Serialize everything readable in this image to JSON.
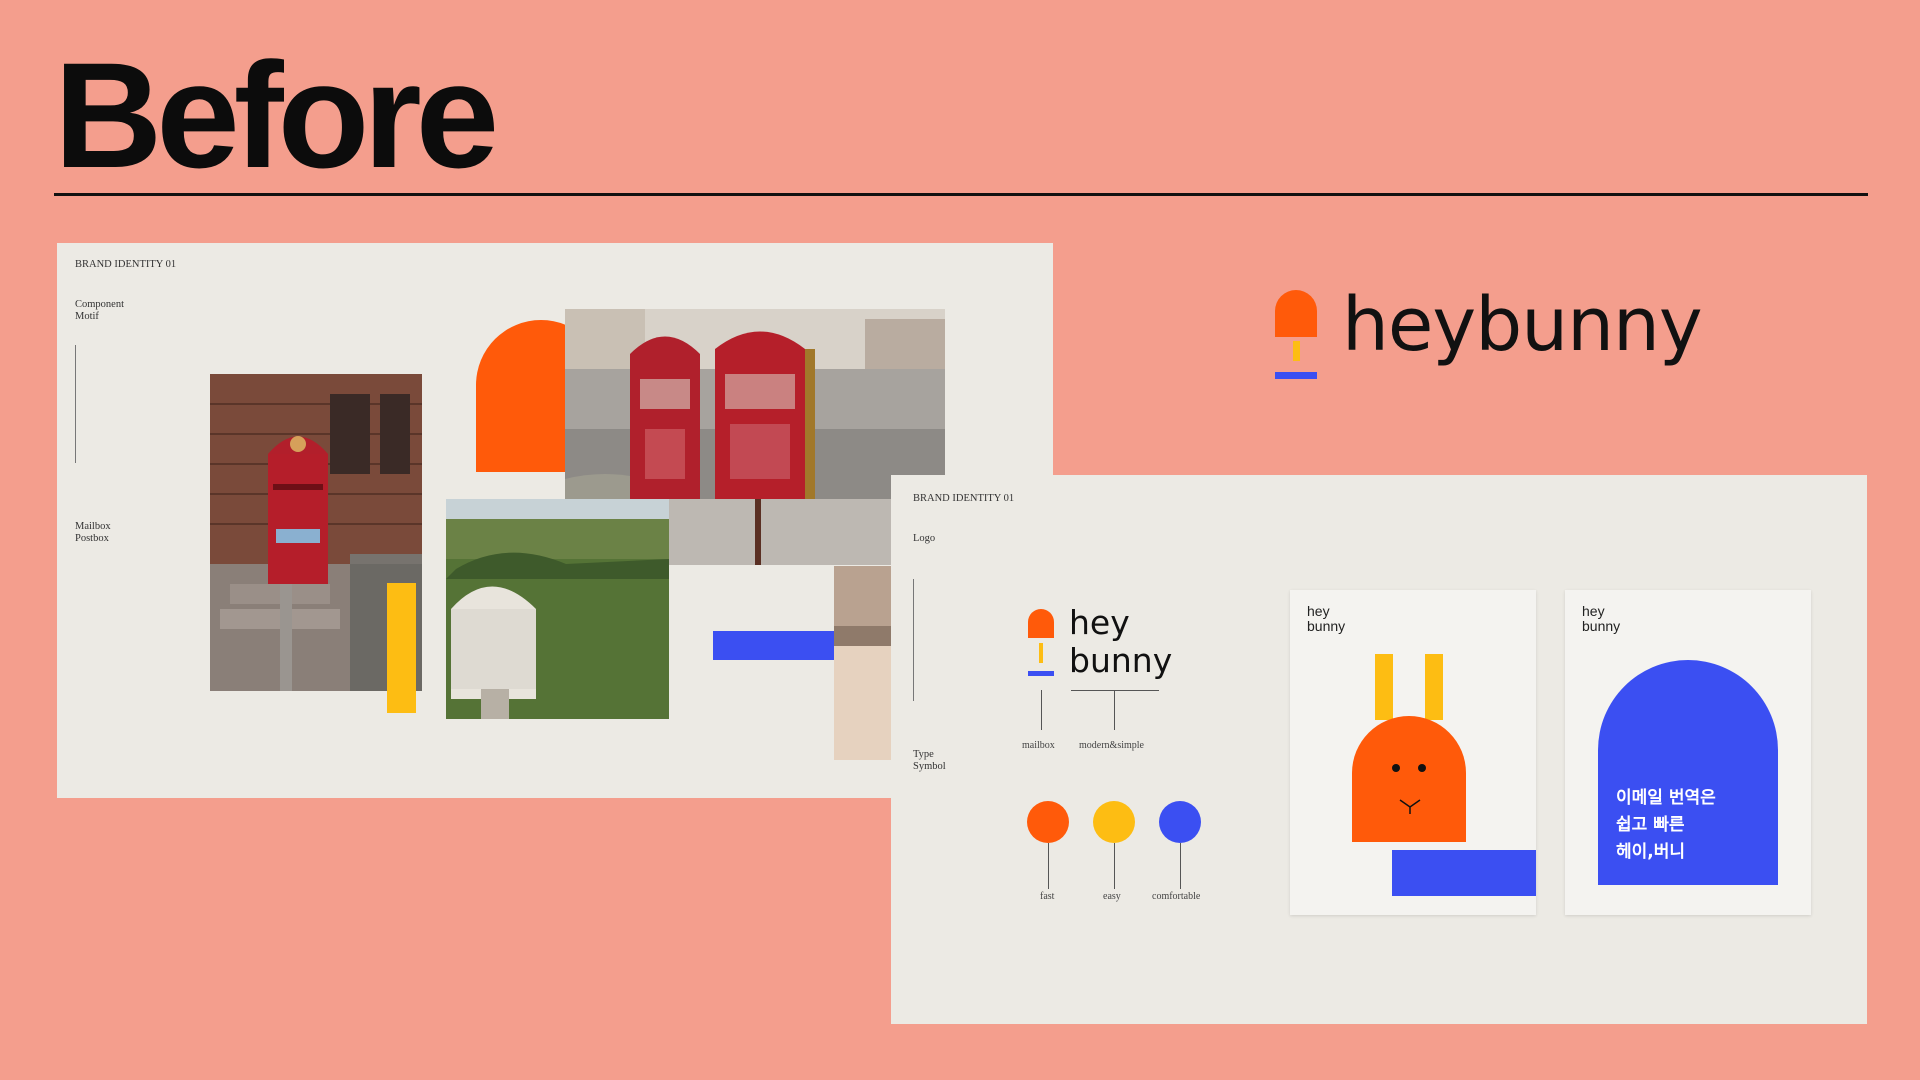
{
  "title": "Before",
  "brand": {
    "wordmark": "heybunny",
    "colors": {
      "orange": "#ff5a0a",
      "yellow": "#fdbd13",
      "blue": "#3b4ff2"
    }
  },
  "slide1": {
    "header": "BRAND IDENTITY 01",
    "section_label": "Component\nMotif",
    "subject_label": "Mailbox\nPostbox"
  },
  "slide2": {
    "header": "BRAND IDENTITY 01",
    "section_label": "Logo",
    "bottom_label": "Type\nSymbol",
    "logo_word1": "hey",
    "logo_word2": "bunny",
    "logo_captions": [
      "mailbox",
      "modern&simple"
    ],
    "values": [
      {
        "label": "fast",
        "color": "#ff5a0a"
      },
      {
        "label": "easy",
        "color": "#fdbd13"
      },
      {
        "label": "comfortable",
        "color": "#3b4ff2"
      }
    ],
    "card1_brand": "hey\nbunny",
    "card2_brand": "hey\nbunny",
    "card2_text": "이메일 번역은\n쉽고 빠른\n헤이,버니"
  }
}
